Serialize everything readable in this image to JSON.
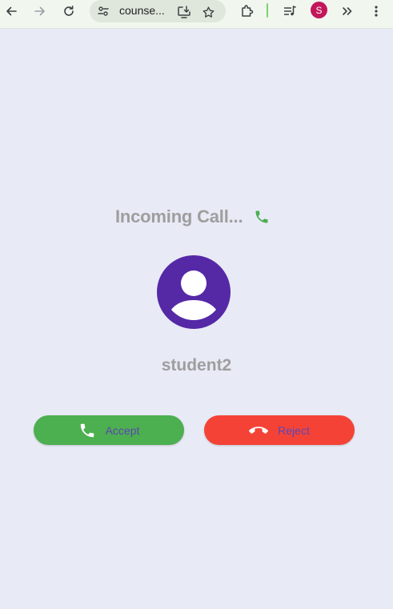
{
  "browser": {
    "url": "counse...",
    "profile_initial": "S",
    "icons": {
      "back": "arrow-left-icon",
      "forward": "arrow-right-icon",
      "reload": "reload-icon",
      "site_info": "tune-icon",
      "install": "install-app-icon",
      "bookmark": "star-icon",
      "extensions": "puzzle-icon",
      "media": "media-control-icon",
      "more_tabs": "double-chevron-icon",
      "menu": "kebab-menu-icon"
    },
    "colors": {
      "toolbar_bg": "#f1f6ef",
      "omnibox_bg": "#dfe7dc",
      "avatar_bg": "#c2185b"
    }
  },
  "call": {
    "status_text": "Incoming Call...",
    "status_icon": "phone-icon",
    "caller_name": "student2",
    "avatar_icon": "person-icon",
    "accept_label": "Accept",
    "reject_label": "Reject",
    "colors": {
      "background": "#e8eaf6",
      "avatar": "#5528a6",
      "accept": "#4caf50",
      "reject": "#f44336",
      "button_text": "#5e45b3",
      "status_icon": "#4caf50"
    }
  }
}
